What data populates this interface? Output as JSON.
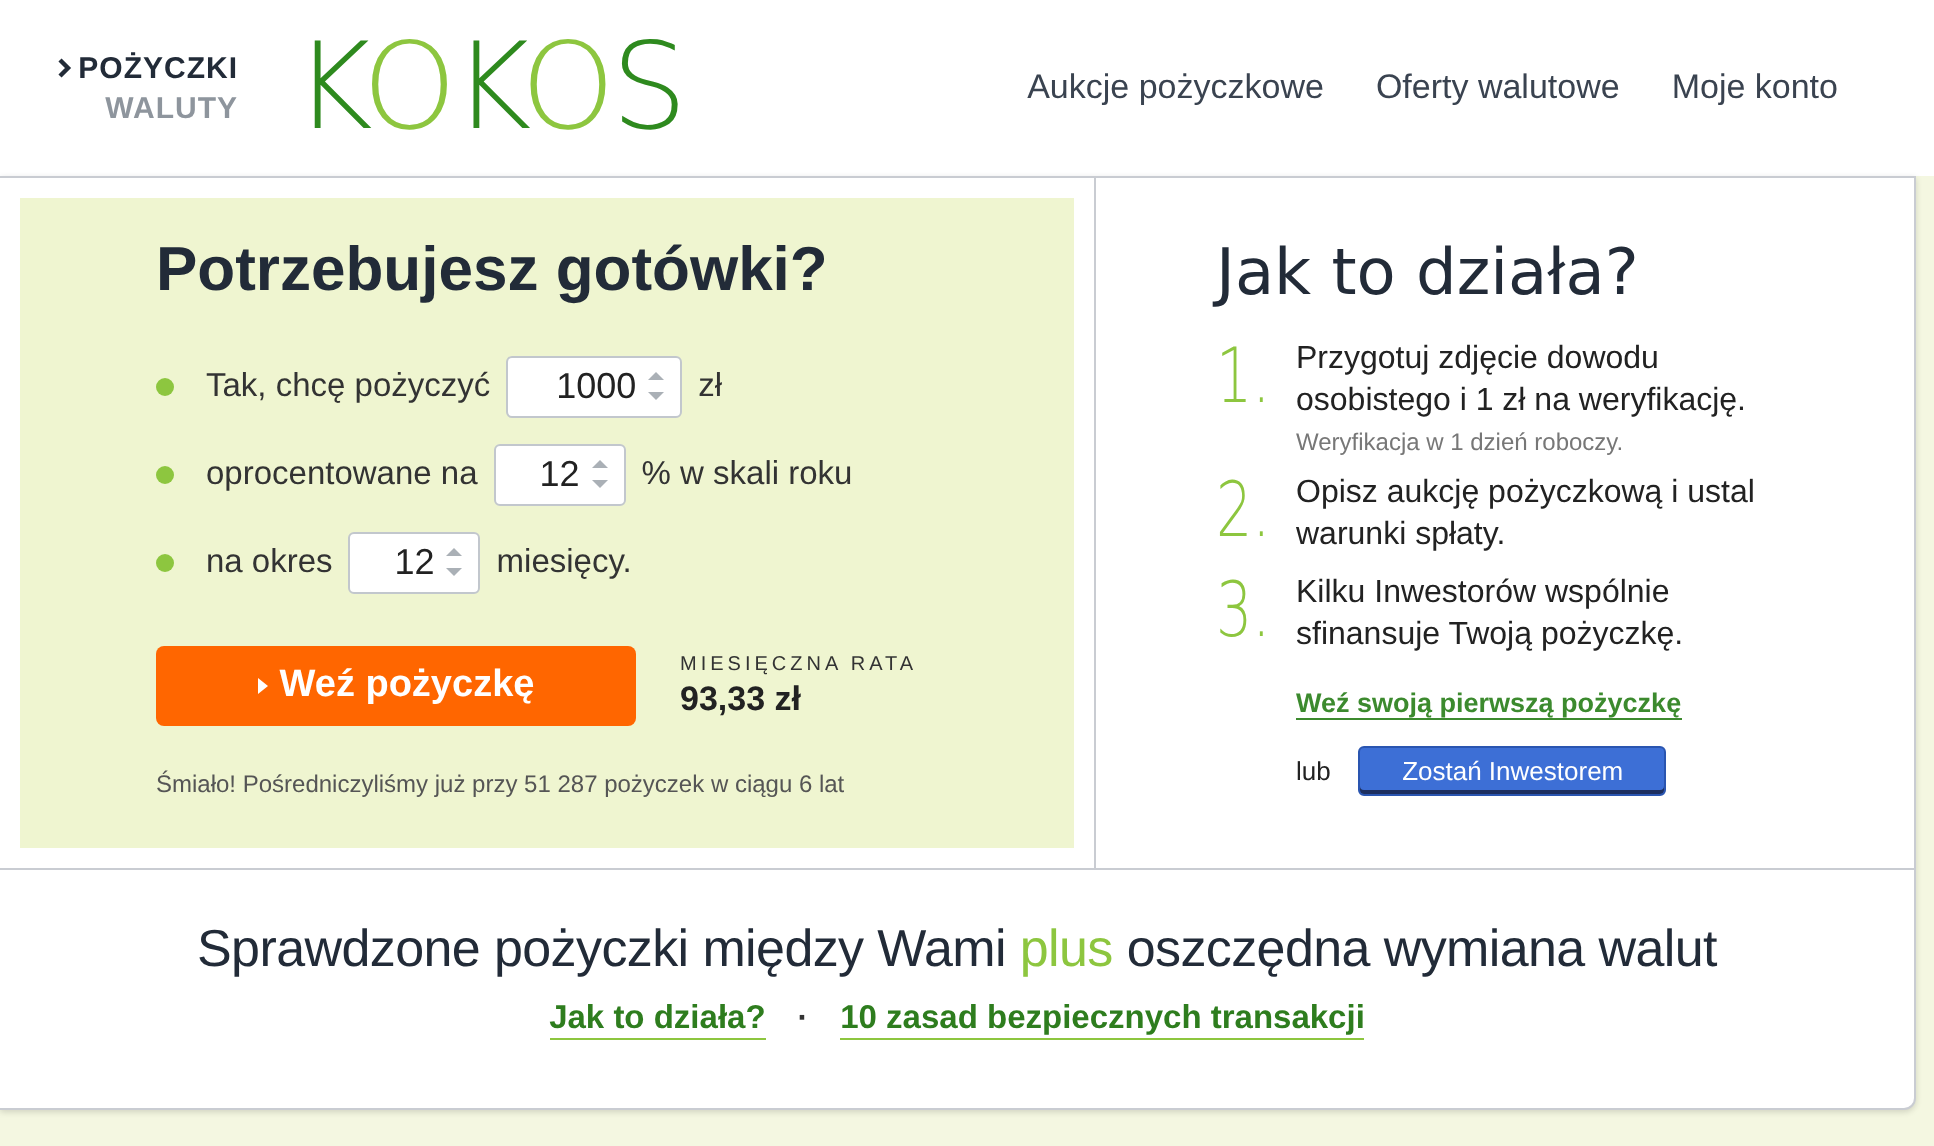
{
  "header": {
    "brand_links": [
      {
        "label": "POŻYCZKI",
        "selected": true
      },
      {
        "label": "WALUTY",
        "selected": false
      }
    ],
    "logo": "KOKOS",
    "nav": [
      "Aukcje pożyczkowe",
      "Oferty walutowe",
      "Moje konto"
    ]
  },
  "loan_form": {
    "title": "Potrzebujesz gotówki?",
    "rows": [
      {
        "before": "Tak, chcę pożyczyć",
        "value": "1000",
        "after": "zł"
      },
      {
        "before": "oprocentowane na",
        "value": "12",
        "after": "% w skali roku"
      },
      {
        "before": "na okres",
        "value": "12",
        "after": "miesięcy."
      }
    ],
    "button": "Weź pożyczkę",
    "rate_label": "MIESIĘCZNA RATA",
    "rate_value": "93,33 zł",
    "note": "Śmiało! Pośredniczyliśmy już przy 51 287 pożyczek w ciągu 6 lat"
  },
  "how_it_works": {
    "title": "Jak to działa?",
    "steps": [
      {
        "number": "1.",
        "text": "Przygotuj zdjęcie dowodu osobistego i 1 zł na weryfikację.",
        "note": "Weryfikacja w 1 dzień roboczy."
      },
      {
        "number": "2.",
        "text": "Opisz aukcję pożyczkową i ustal warunki spłaty."
      },
      {
        "number": "3.",
        "text": "Kilku Inwestorów wspólnie sfinansuje Twoją pożyczkę."
      }
    ],
    "link": "Weź swoją pierwszą pożyczkę",
    "or": "lub",
    "button": "Zostań Inwestorem"
  },
  "footer": {
    "tagline": [
      {
        "text": "Sprawdzone pożyczki między Wami",
        "highlight": false
      },
      {
        "text": "plus",
        "highlight": true
      },
      {
        "text": "oszczędna wymiana walut",
        "highlight": false
      }
    ],
    "links": [
      "Jak to działa?",
      "10 zasad bezpiecznych transakcji"
    ],
    "separator": "·"
  }
}
